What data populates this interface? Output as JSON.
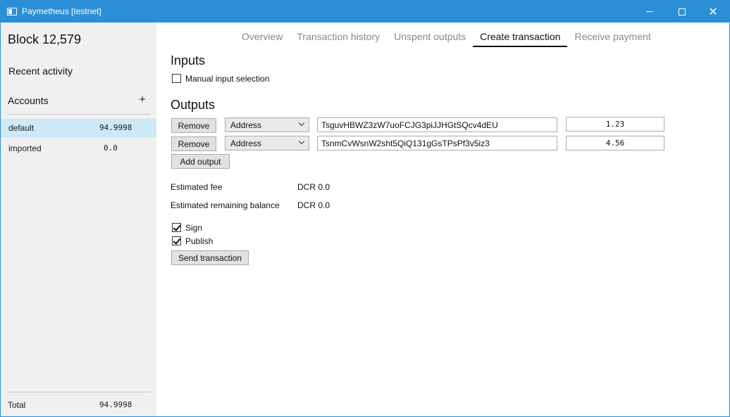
{
  "window": {
    "title": "Paymetheus [testnet]",
    "minimize_glyph": "",
    "close_glyph": "✕",
    "accent_color": "#2b8fd6"
  },
  "sidebar": {
    "block_height": "Block 12,579",
    "recent_activity": "Recent activity",
    "accounts_header": "Accounts",
    "add_account": "+",
    "accounts": [
      {
        "name": "default",
        "balance": "94.9998",
        "selected": true
      },
      {
        "name": "imported",
        "balance": "0.0",
        "selected": false
      }
    ],
    "total_label": "Total",
    "total_value": "94.9998",
    "selected_color": "#cde8f7"
  },
  "tabs": [
    {
      "label": "Overview",
      "active": false
    },
    {
      "label": "Transaction history",
      "active": false
    },
    {
      "label": "Unspent outputs",
      "active": false
    },
    {
      "label": "Create transaction",
      "active": true
    },
    {
      "label": "Receive payment",
      "active": false
    }
  ],
  "inputs": {
    "heading": "Inputs",
    "manual_selection_label": "Manual input selection",
    "manual_selection_checked": false
  },
  "outputs": {
    "heading": "Outputs",
    "rows": [
      {
        "remove_label": "Remove",
        "type": "Address",
        "address": "TsguvHBWZ3zW7uoFCJG3piJJHGtSQcv4dEU",
        "amount": "1.23"
      },
      {
        "remove_label": "Remove",
        "type": "Address",
        "address": "TsnmCvWsnW2sht5QiQ131gGsTPsPf3v5iz3",
        "amount": "4.56"
      }
    ],
    "add_output_label": "Add output"
  },
  "summary": {
    "estimated_fee_label": "Estimated fee",
    "estimated_fee_value": "DCR 0.0",
    "remaining_balance_label": "Estimated remaining balance",
    "remaining_balance_value": "DCR 0.0"
  },
  "options": {
    "sign_label": "Sign",
    "sign_checked": true,
    "publish_label": "Publish",
    "publish_checked": true
  },
  "send_button_label": "Send transaction"
}
